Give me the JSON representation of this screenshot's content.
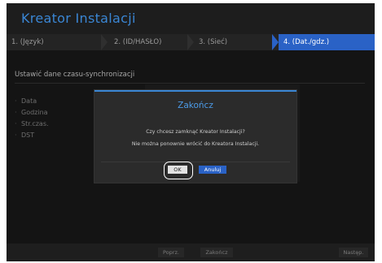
{
  "header": {
    "title": "Kreator Instalacji"
  },
  "steps": [
    {
      "label": "1. (Język)"
    },
    {
      "label": "2. (ID/HASŁO)"
    },
    {
      "label": "3. (Sieć)"
    },
    {
      "label": "4. (Dat./gdz.)"
    }
  ],
  "section": {
    "label": "Ustawić dane czasu-synchronizacji"
  },
  "fields": [
    "Data",
    "Godzina",
    "Str.czas.",
    "DST"
  ],
  "dialog": {
    "title": "Zakończ",
    "line1": "Czy chcesz zamknąć Kreator Instalacji?",
    "line2": "Nie można ponownie wrócić do Kreatora Instalacji.",
    "ok": "OK",
    "cancel": "Anuluj"
  },
  "footer": {
    "prev": "Poprz.",
    "finish": "Zakończ",
    "next": "Następ."
  },
  "colors": {
    "accent": "#3a86d4",
    "active_step": "#2a62c6",
    "background": "#141414"
  }
}
